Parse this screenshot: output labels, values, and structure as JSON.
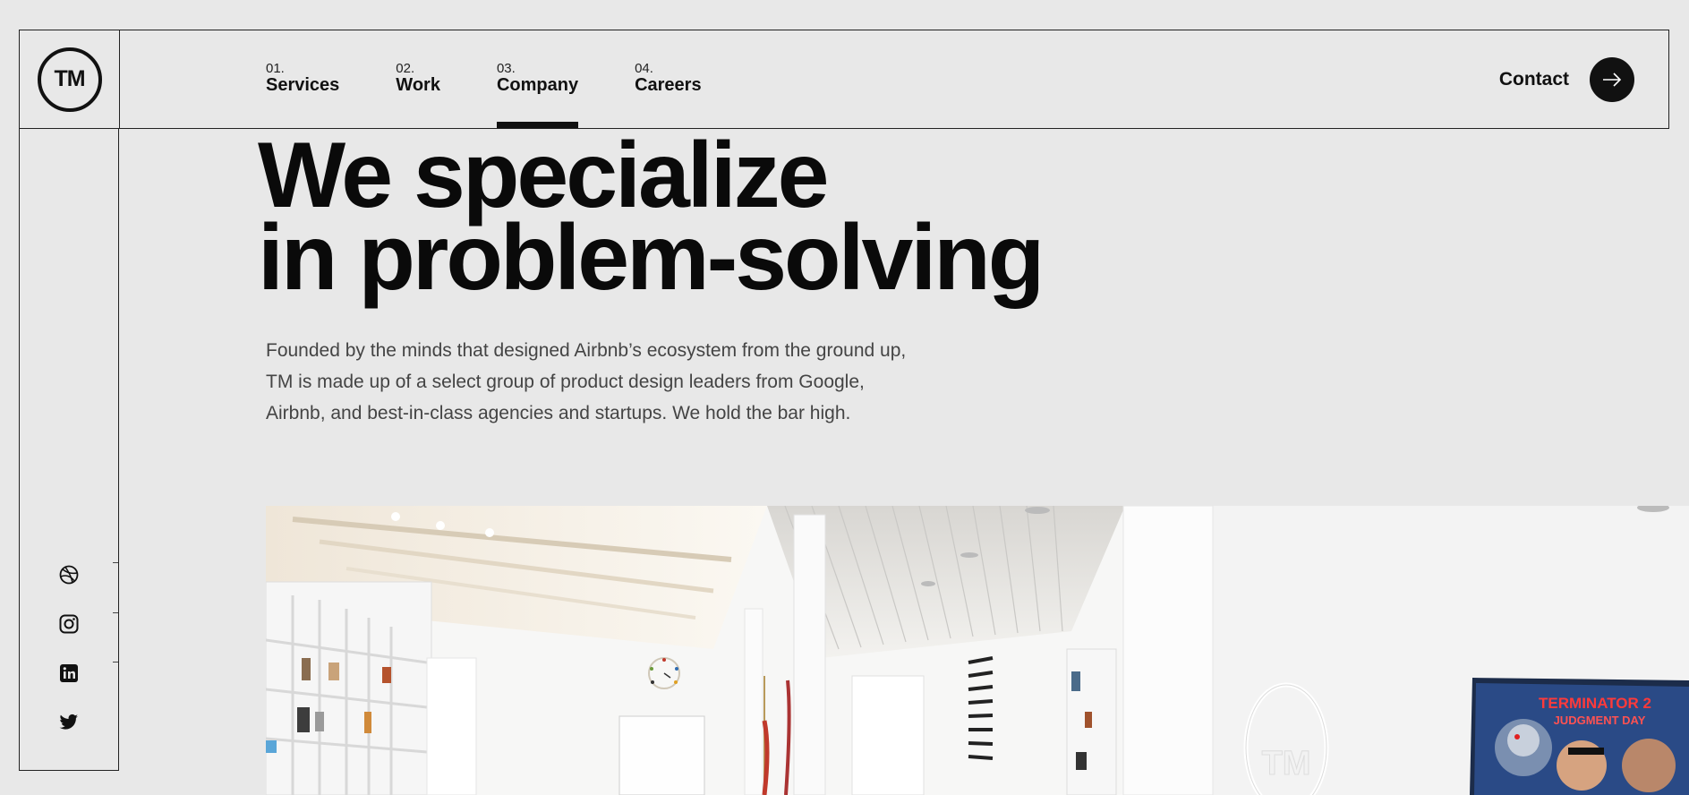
{
  "brand": {
    "logo_text": "TM"
  },
  "nav": {
    "items": [
      {
        "num": "01.",
        "label": "Services",
        "active": false
      },
      {
        "num": "02.",
        "label": "Work",
        "active": false
      },
      {
        "num": "03.",
        "label": "Company",
        "active": true
      },
      {
        "num": "04.",
        "label": "Careers",
        "active": false
      }
    ]
  },
  "contact": {
    "label": "Contact",
    "icon": "arrow-right-icon"
  },
  "social": {
    "icons": [
      "dribbble-icon",
      "instagram-icon",
      "linkedin-icon",
      "twitter-icon"
    ]
  },
  "hero": {
    "headline_line1": "We specialize",
    "headline_line2": "in problem-solving",
    "intro": "Founded by the minds that designed Airbnb’s ecosystem from the ground up, TM is made up of a select group of product design leaders from Google, Airbnb, and best-in-class agencies and startups. We hold the bar high."
  },
  "photo": {
    "neon_sign_text": "TM",
    "pinball_marquee_line1": "TERMINATOR 2",
    "pinball_marquee_line2": "JUDGMENT DAY"
  },
  "colors": {
    "background": "#e8e8e8",
    "ink": "#111111",
    "accent_dark": "#111111"
  }
}
